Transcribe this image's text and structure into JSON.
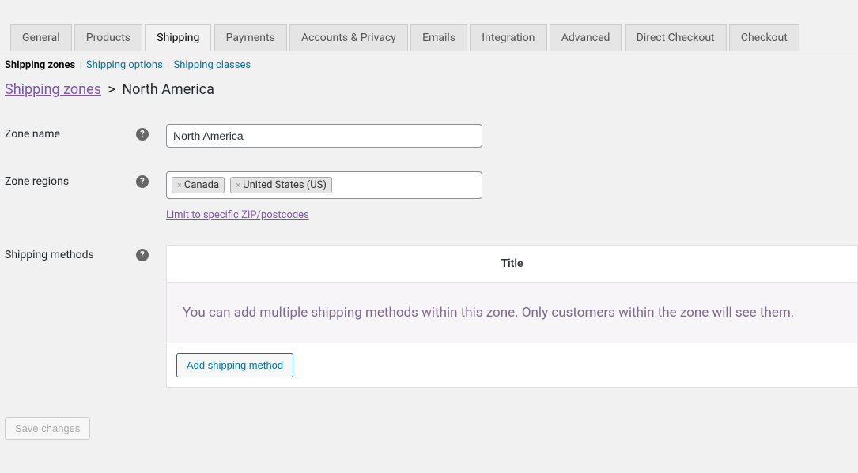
{
  "tabs": [
    {
      "label": "General"
    },
    {
      "label": "Products"
    },
    {
      "label": "Shipping"
    },
    {
      "label": "Payments"
    },
    {
      "label": "Accounts & Privacy"
    },
    {
      "label": "Emails"
    },
    {
      "label": "Integration"
    },
    {
      "label": "Advanced"
    },
    {
      "label": "Direct Checkout"
    },
    {
      "label": "Checkout"
    }
  ],
  "subtabs": {
    "shipping_zones": "Shipping zones",
    "shipping_options": "Shipping options",
    "shipping_classes": "Shipping classes"
  },
  "breadcrumb": {
    "root": "Shipping zones",
    "current": "North America"
  },
  "form": {
    "zone_name_label": "Zone name",
    "zone_name_value": "North America",
    "zone_regions_label": "Zone regions",
    "regions": [
      {
        "label": "Canada"
      },
      {
        "label": "United States (US)"
      }
    ],
    "limit_link": "Limit to specific ZIP/postcodes",
    "shipping_methods_label": "Shipping methods",
    "table_header_title": "Title",
    "placeholder_text": "You can add multiple shipping methods within this zone. Only customers within the zone will see them.",
    "add_method_button": "Add shipping method"
  },
  "save_button": "Save changes"
}
